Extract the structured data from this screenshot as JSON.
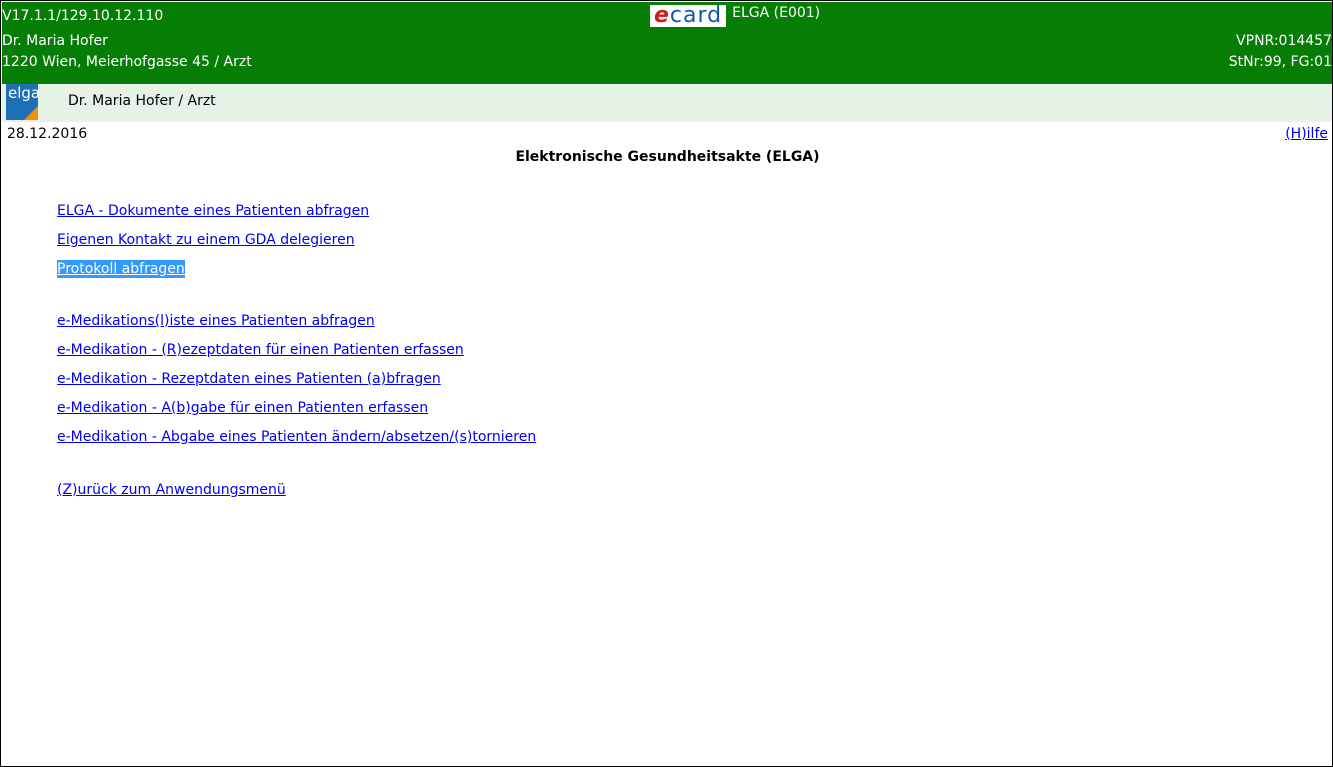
{
  "header": {
    "version": "V17.1.1/129.10.12.110",
    "doctor": "Dr. Maria Hofer",
    "address": "1220 Wien, Meierhofgasse 45 / Arzt",
    "vpnr": "VPNR:014457",
    "stnr": "StNr:99, FG:01",
    "logo_text_e": "e",
    "logo_text_card": "card",
    "app_name": "ELGA (E001)",
    "brand_color": "#067e06"
  },
  "subbar": {
    "logo_text": "elga",
    "user": "Dr. Maria Hofer / Arzt"
  },
  "date": "28.12.2016",
  "help_link": "(H)ilfe",
  "page_title": "Elektronische Gesundheitsakte (ELGA)",
  "menu": [
    {
      "label": "ELGA - Dokumente eines Patienten abfragen",
      "selected": false
    },
    {
      "label": "Eigenen Kontakt zu einem GDA delegieren",
      "selected": false
    },
    {
      "label": "Protokoll abfragen",
      "selected": true
    },
    {
      "label": "e-Medikations(l)iste eines Patienten abfragen",
      "selected": false
    },
    {
      "label": "e-Medikation - (R)ezeptdaten für einen Patienten erfassen",
      "selected": false
    },
    {
      "label": "e-Medikation - Rezeptdaten eines Patienten (a)bfragen",
      "selected": false
    },
    {
      "label": "e-Medikation - A(b)gabe für einen Patienten erfassen",
      "selected": false
    },
    {
      "label": "e-Medikation - Abgabe eines Patienten ändern/absetzen/(s)tornieren",
      "selected": false
    },
    {
      "label": "(Z)urück zum Anwendungsmenü",
      "selected": false
    }
  ]
}
